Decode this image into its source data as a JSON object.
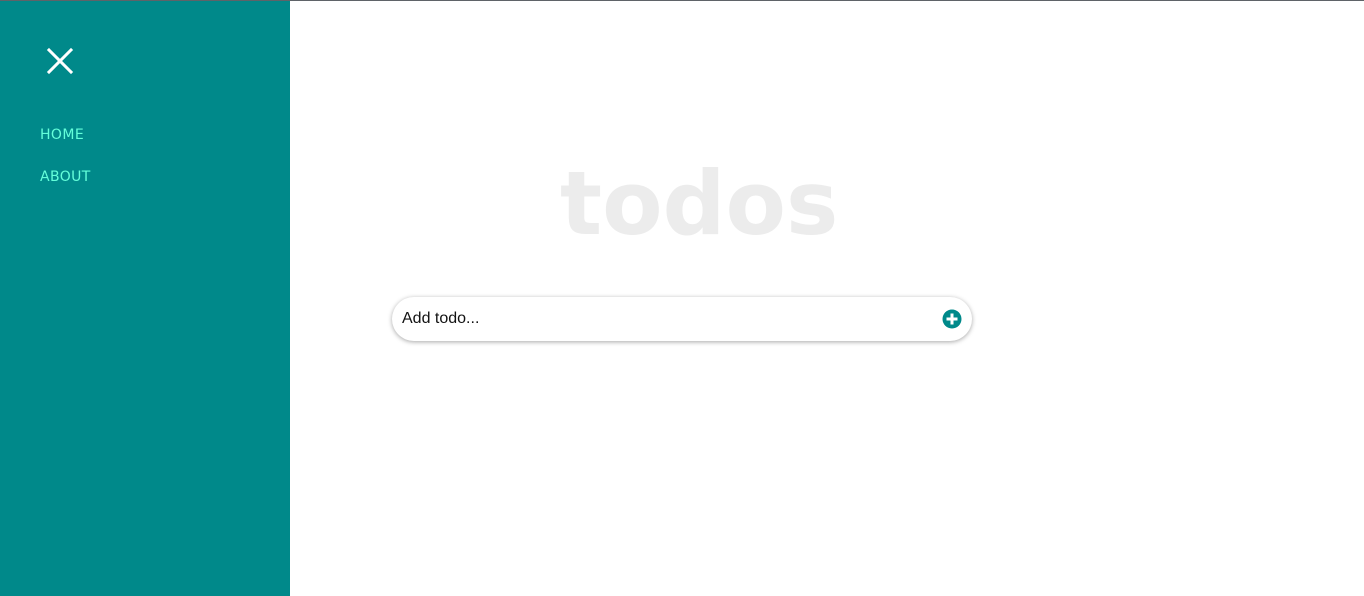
{
  "sidebar": {
    "close_icon": "close-icon",
    "nav_items": [
      {
        "label": "HOME"
      },
      {
        "label": "ABOUT"
      }
    ]
  },
  "main": {
    "title": "todos",
    "input": {
      "placeholder": "Add todo...",
      "value": ""
    },
    "add_icon": "plus-circle-icon"
  },
  "colors": {
    "sidebar_bg": "#00898a",
    "nav_link": "#64ffda",
    "title": "#ececec",
    "accent": "#00898a"
  }
}
